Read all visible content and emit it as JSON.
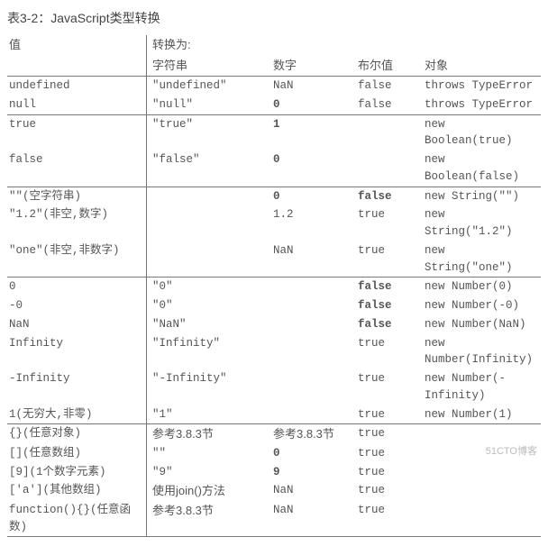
{
  "caption": "表3-2：JavaScript类型转换",
  "head": {
    "value": "值",
    "convertTo": "转换为:",
    "c2": "字符串",
    "c3": "数字",
    "c4": "布尔值",
    "c5": "对象"
  },
  "sections": [
    {
      "rows": [
        {
          "v": "undefined",
          "s": "\"undefined\"",
          "n": "NaN",
          "b": "false",
          "o": "throws TypeError"
        },
        {
          "v": "null",
          "s": "\"null\"",
          "n": "0",
          "nb": true,
          "b": "false",
          "o": "throws TypeError"
        }
      ]
    },
    {
      "rows": [
        {
          "v": "true",
          "s": "\"true\"",
          "n": "1",
          "nb": true,
          "b": "",
          "o": "new Boolean(true)"
        },
        {
          "v": "false",
          "s": "\"false\"",
          "n": "0",
          "nb": true,
          "b": "",
          "o": "new Boolean(false)"
        }
      ]
    },
    {
      "rows": [
        {
          "v": "\"\"(空字符串)",
          "s": "",
          "n": "0",
          "nb": true,
          "b": "false",
          "bb": true,
          "o": "new String(\"\")"
        },
        {
          "v": "\"1.2\"(非空,数字)",
          "s": "",
          "n": "1.2",
          "b": "true",
          "o": "new String(\"1.2\")"
        },
        {
          "v": "\"one\"(非空,非数字)",
          "s": "",
          "n": "NaN",
          "b": "true",
          "o": "new String(\"one\")"
        }
      ]
    },
    {
      "rows": [
        {
          "v": "0",
          "s": "\"0\"",
          "n": "",
          "b": "false",
          "bb": true,
          "o": "new Number(0)"
        },
        {
          "v": "-0",
          "s": "\"0\"",
          "n": "",
          "b": "false",
          "bb": true,
          "o": "new Number(-0)"
        },
        {
          "v": "NaN",
          "s": "\"NaN\"",
          "n": "",
          "b": "false",
          "bb": true,
          "o": "new Number(NaN)"
        },
        {
          "v": "Infinity",
          "s": "\"Infinity\"",
          "n": "",
          "b": "true",
          "o": "new Number(Infinity)"
        },
        {
          "v": "-Infinity",
          "s": "\"-Infinity\"",
          "n": "",
          "b": "true",
          "o": "new Number(-Infinity)"
        },
        {
          "v": "1(无穷大,非零)",
          "s": "\"1\"",
          "n": "",
          "b": "true",
          "o": "new Number(1)"
        }
      ]
    },
    {
      "rows": [
        {
          "v": "{}(任意对象)",
          "s": "参考3.8.3节",
          "sSerif": true,
          "n": "参考3.8.3节",
          "nSerif": true,
          "b": "true",
          "o": ""
        },
        {
          "v": "[](任意数组)",
          "s": "\"\"",
          "n": "0",
          "nb": true,
          "b": "true",
          "o": ""
        },
        {
          "v": "[9](1个数字元素)",
          "s": "\"9\"",
          "n": "9",
          "nb": true,
          "b": "true",
          "o": ""
        },
        {
          "v": "['a'](其他数组)",
          "s": "使用join()方法",
          "sSerif": true,
          "n": "NaN",
          "b": "true",
          "o": ""
        },
        {
          "v": "function(){}(任意函数)",
          "s": "参考3.8.3节",
          "sSerif": true,
          "n": "NaN",
          "b": "true",
          "o": ""
        }
      ]
    }
  ],
  "watermark": "51CTO博客"
}
